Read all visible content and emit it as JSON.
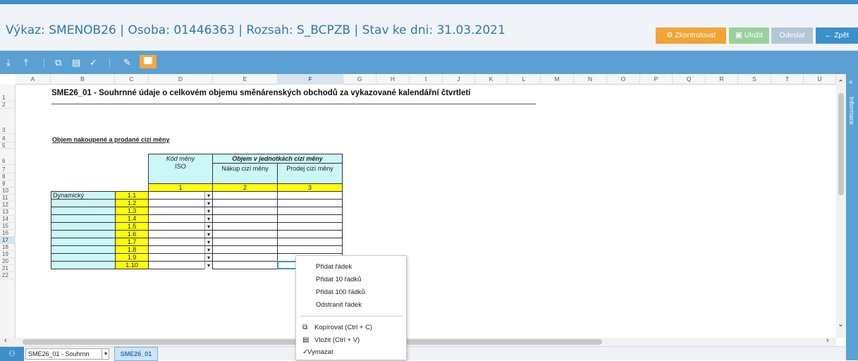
{
  "header": {
    "title": "Výkaz: SMENOB26 | Osoba: 01446363 | Rozsah: S_BCPZB | Stav ke dni: 31.03.2021",
    "buttons": {
      "check": "Zkontrolovat",
      "save": "Uložit",
      "send": "Odeslat",
      "back": "Zpět"
    }
  },
  "colors": {
    "accent": "#3d8fc9",
    "check": "#f0a437",
    "save": "#9ad19c",
    "cyan": "#ccf7f8",
    "yellow": "#fffd0c"
  },
  "toolbar": {
    "icons": [
      "download-icon",
      "upload-icon",
      "copy-icon",
      "paste-icon",
      "clear-icon",
      "edit-icon",
      "comment-icon"
    ]
  },
  "grid": {
    "columns": [
      "A",
      "B",
      "C",
      "D",
      "E",
      "F",
      "G",
      "H",
      "I",
      "J",
      "K",
      "L",
      "M",
      "N",
      "O",
      "P",
      "Q",
      "R",
      "S",
      "T",
      "U"
    ],
    "rows": [
      "1",
      "2",
      "3",
      "4",
      "5",
      "6",
      "7",
      "8",
      "9",
      "10",
      "11",
      "12",
      "13",
      "14",
      "15",
      "16",
      "17",
      "18",
      "19",
      "20",
      "21",
      "22"
    ],
    "selected_column": "F",
    "selected_row": "17"
  },
  "sheet": {
    "title": "SME26_01 - Souhrnné údaje o celkovém objemu směnárenských obchodů za vykazované kalendářní čtvrtletí",
    "subtitle": "Objem nakoupené a prodané cizí měny",
    "table": {
      "kod_header": "Kód měny",
      "objem_header": "Objem v jednotkách cizí měny",
      "iso": "ISO",
      "nakup": "Nákup cizí měny",
      "prodej": "Prodej cizí měny",
      "col_num1": "1",
      "col_num2": "2",
      "col_num3": "3",
      "row_label": "Dynamický",
      "row_codes": [
        "1.1",
        "1.2",
        "1.3",
        "1.4",
        "1.5",
        "1.6",
        "1.7",
        "1.8",
        "1.9",
        "1.10"
      ]
    }
  },
  "context_menu": {
    "add_row": "Přidat řádek",
    "add_10": "Přidat 10 řádků",
    "add_100": "Přidat 100 řádků",
    "remove_row": "Odstranit řádek",
    "copy": "Kopírovat (Ctrl + C)",
    "paste": "Vložit (Ctrl + V)",
    "clear": "Vymazat"
  },
  "side_panel": {
    "label": "Informace"
  },
  "footer": {
    "sheet_select": "SME26_01 - Souhrnn",
    "sheet_tab": "SME26_01"
  }
}
